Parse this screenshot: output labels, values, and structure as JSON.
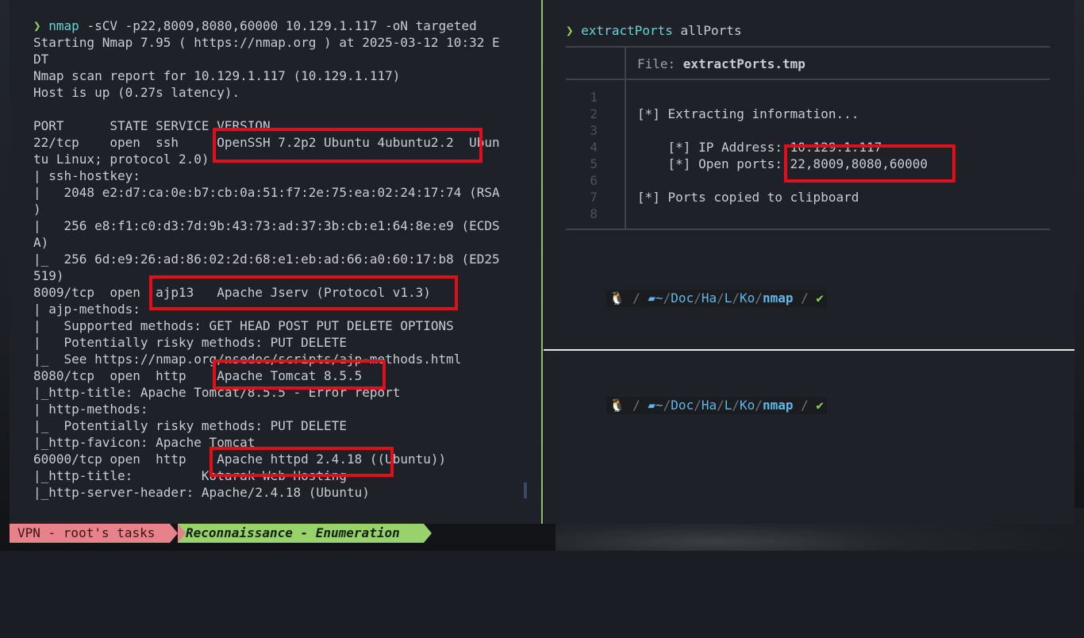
{
  "left_pane": {
    "prompt_symbol": "❯",
    "command": "nmap",
    "command_args": "-sCV -p22,8009,8080,60000 10.129.1.117 -oN targeted",
    "output_lines": [
      "Starting Nmap 7.95 ( https://nmap.org ) at 2025-03-12 10:32 E",
      "DT",
      "Nmap scan report for 10.129.1.117 (10.129.1.117)",
      "Host is up (0.27s latency).",
      "",
      "PORT      STATE SERVICE VERSION",
      "22/tcp    open  ssh     OpenSSH 7.2p2 Ubuntu 4ubuntu2.2  Ubun",
      "tu Linux; protocol 2.0)",
      "| ssh-hostkey:",
      "|   2048 e2:d7:ca:0e:b7:cb:0a:51:f7:2e:75:ea:02:24:17:74 (RSA",
      ")",
      "|   256 e8:f1:c0:d3:7d:9b:43:73:ad:37:3b:cb:e1:64:8e:e9 (ECDS",
      "A)",
      "|_  256 6d:e9:26:ad:86:02:2d:68:e1:eb:ad:66:a0:60:17:b8 (ED25",
      "519)",
      "8009/tcp  open  ajp13   Apache Jserv (Protocol v1.3)",
      "| ajp-methods:",
      "|   Supported methods: GET HEAD POST PUT DELETE OPTIONS",
      "|   Potentially risky methods: PUT DELETE",
      "|_  See https://nmap.org/nsedoc/scripts/ajp-methods.html",
      "8080/tcp  open  http    Apache Tomcat 8.5.5",
      "|_http-title: Apache Tomcat/8.5.5 - Error report",
      "| http-methods:",
      "|_  Potentially risky methods: PUT DELETE",
      "|_http-favicon: Apache Tomcat",
      "60000/tcp open  http    Apache httpd 2.4.18 ((Ubuntu))",
      "|_http-title:         Kotarak Web Hosting",
      "|_http-server-header: Apache/2.4.18 (Ubuntu)"
    ]
  },
  "right_top_pane": {
    "prompt_symbol": "❯",
    "command": "extractPorts",
    "command_args": "allPorts",
    "file_label": "File: ",
    "file_name": "extractPorts.tmp",
    "line_numbers": [
      "1",
      "2",
      "3",
      "4",
      "5",
      "6",
      "7",
      "8"
    ],
    "file_lines": [
      "",
      "[*] Extracting information...",
      "",
      "    [*] IP Address: 10.129.1.117",
      "    [*] Open ports: 22,8009,8080,60000",
      "",
      "[*] Ports copied to clipboard",
      ""
    ]
  },
  "shell_prompt": {
    "os_icon": "linux-tux-icon",
    "separator": "/",
    "folder_icon": "folder-open-icon",
    "home": "~",
    "path_parts": [
      "Doc",
      "Ha",
      "L",
      "Ko"
    ],
    "current_dir": "nmap",
    "status_ok": "✔"
  },
  "status_bar": {
    "session": "VPN - root's tasks",
    "window_name": "Reconnaissance - Enumeration"
  },
  "colors": {
    "highlight_box": "#e0101a",
    "active_border": "#8fbf6a",
    "prompt": "#8fd35b",
    "command": "#61d6d6",
    "path": "#5fb7e8"
  }
}
